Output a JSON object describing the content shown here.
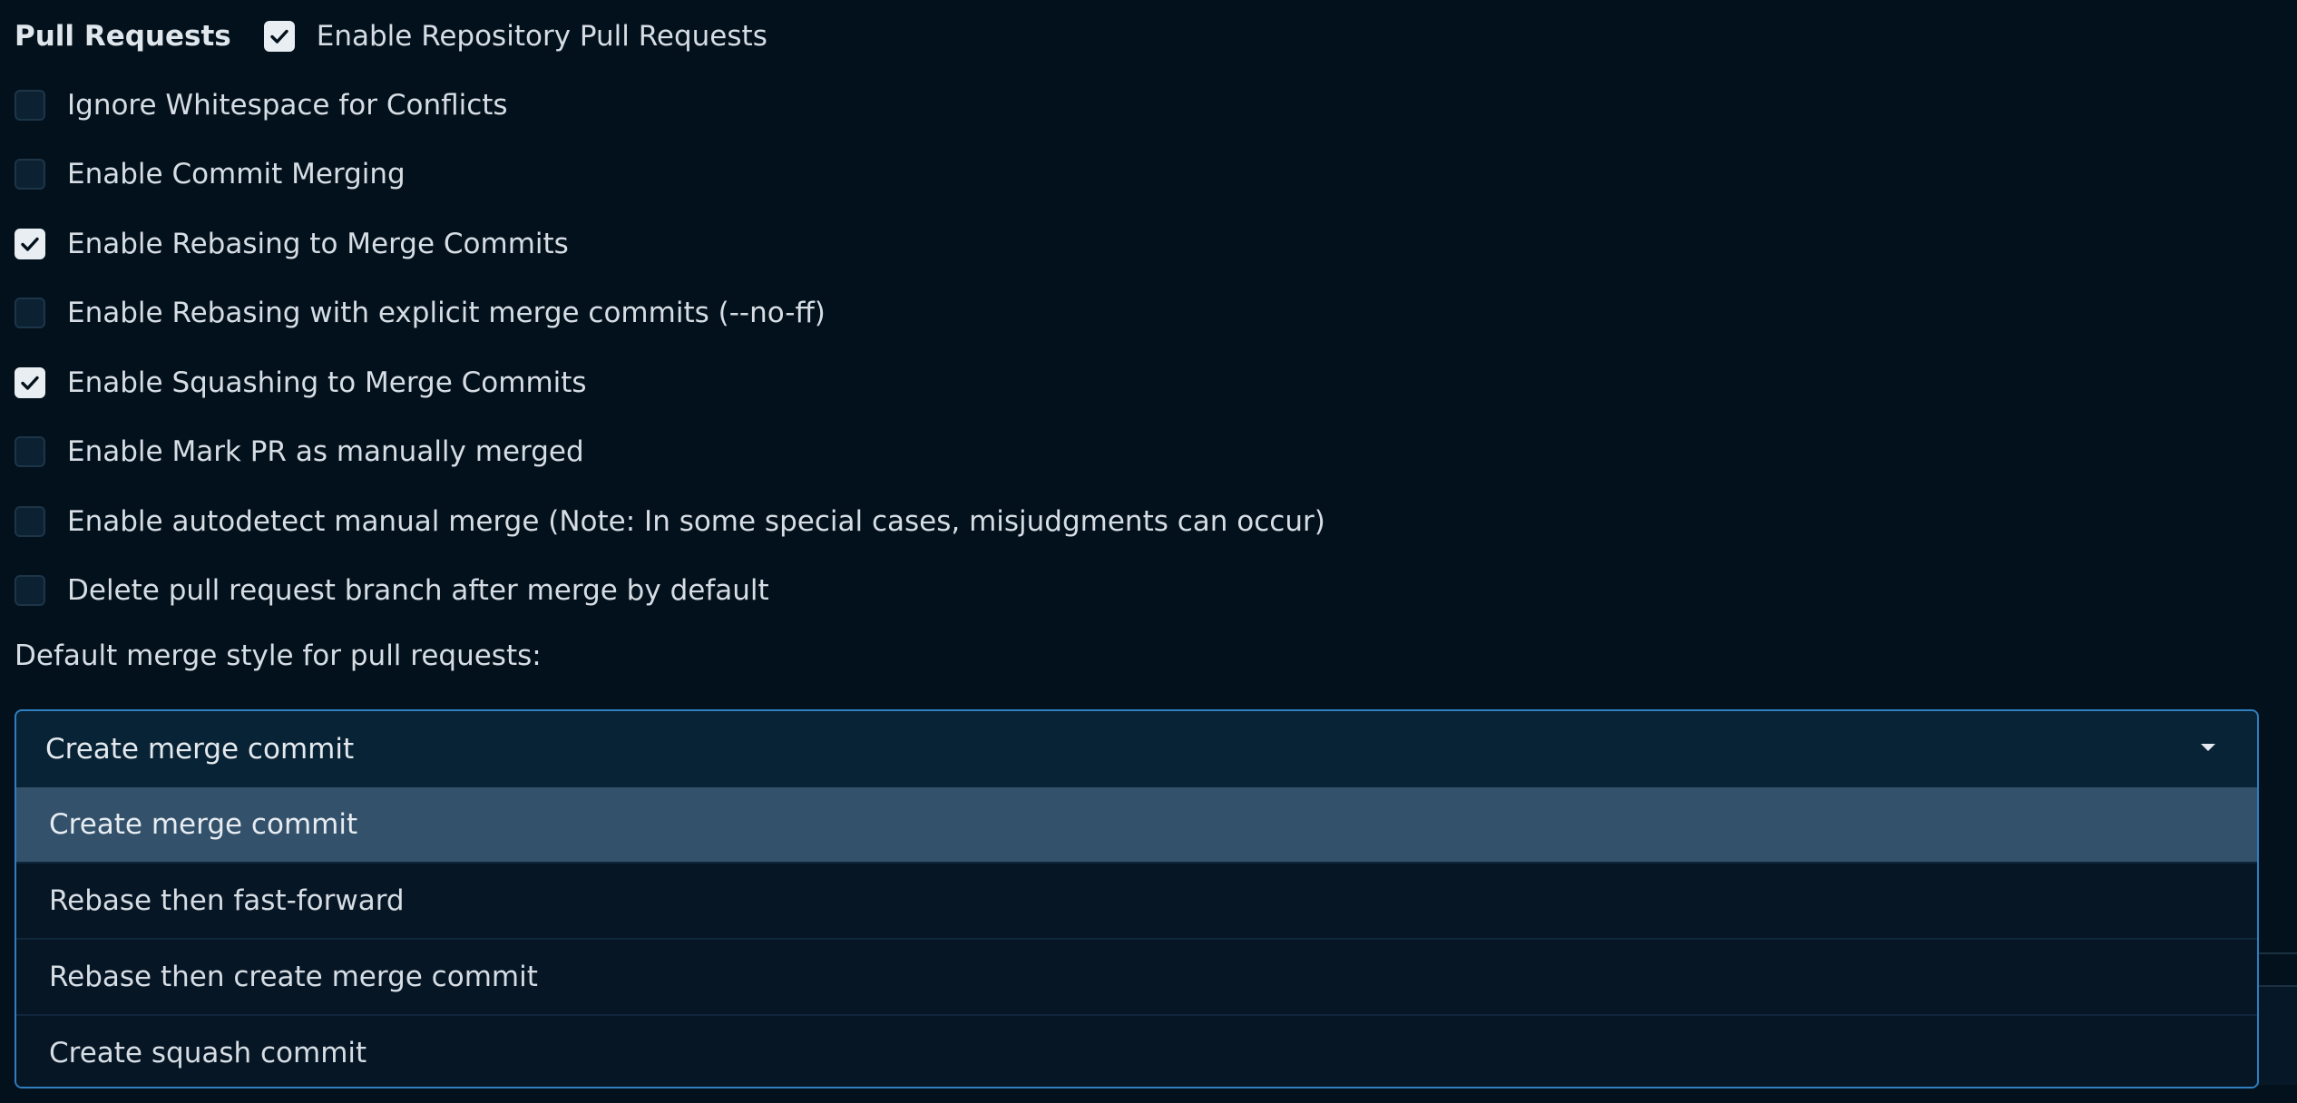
{
  "section": {
    "label": "Pull Requests"
  },
  "checkboxes": [
    {
      "label": "Enable Repository Pull Requests",
      "checked": true
    },
    {
      "label": "Ignore Whitespace for Conflicts",
      "checked": false
    },
    {
      "label": "Enable Commit Merging",
      "checked": false
    },
    {
      "label": "Enable Rebasing to Merge Commits",
      "checked": true
    },
    {
      "label": "Enable Rebasing with explicit merge commits (--no-ff)",
      "checked": false
    },
    {
      "label": "Enable Squashing to Merge Commits",
      "checked": true
    },
    {
      "label": "Enable Mark PR as manually merged",
      "checked": false
    },
    {
      "label": "Enable autodetect manual merge (Note: In some special cases, misjudgments can occur)",
      "checked": false
    },
    {
      "label": "Delete pull request branch after merge by default",
      "checked": false
    }
  ],
  "merge_style": {
    "label": "Default merge style for pull requests:",
    "selected": "Create merge commit",
    "options": [
      "Create merge commit",
      "Rebase then fast-forward",
      "Rebase then create merge commit",
      "Create squash commit"
    ]
  },
  "colors": {
    "background": "#03111c",
    "accent_border": "#2f7fc1",
    "selected_option": "#33516a"
  }
}
